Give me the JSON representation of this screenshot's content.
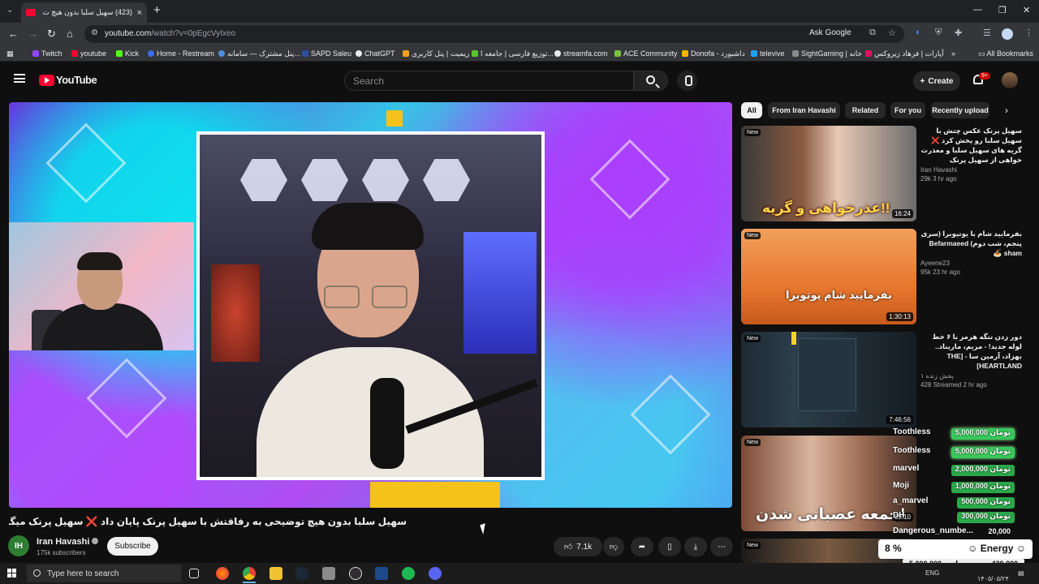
{
  "browser": {
    "tab_title": "(423) سهیل سلبا بدون هیچ ت",
    "url_host": "youtube.com",
    "url_path": "/watch?v=0pEgcVyIxeo",
    "ask_google": "Ask Google"
  },
  "bookmarks": [
    {
      "label": "Twitch",
      "color": "#9146ff"
    },
    {
      "label": "youtube",
      "color": "#ff0033"
    },
    {
      "label": "Kick",
      "color": "#53fc18"
    },
    {
      "label": "Home - Restream",
      "color": "#3d6cf4"
    },
    {
      "label": "پنل مشترک — سامانه...",
      "color": "#4a90e2"
    },
    {
      "label": "SAPD Saleu",
      "color": "#2b4fa3"
    },
    {
      "label": "ChatGPT",
      "color": "#e8eaed"
    },
    {
      "label": "ریمیت | پنل کاربری",
      "color": "#f0a020"
    },
    {
      "label": "توزیع فارسی | جامعه ا...",
      "color": "#5bc236"
    },
    {
      "label": "streamfa.com",
      "color": "#e8eaed"
    },
    {
      "label": "ACE Community",
      "color": "#7cc242"
    },
    {
      "label": "Donofa - داشبورد",
      "color": "#f7b500"
    },
    {
      "label": "televive",
      "color": "#1da1f2"
    },
    {
      "label": "SightGaming | خانه",
      "color": "#8a8a8a"
    },
    {
      "label": "آپارات | فرهاد زیروکس",
      "color": "#e0115f"
    }
  ],
  "all_bookmarks": "All Bookmarks",
  "youtube": {
    "logo": "YouTube",
    "search_placeholder": "Search",
    "create": "Create",
    "notif_count": "9+"
  },
  "video": {
    "title": "سهیل سلبا بدون هیچ توضیحی به رفاقتش با سهیل پرنک پایان داد ❌ سهیل پرنک میگه سلبا ایده منو دزدیده‼️",
    "channel": "Iran Havashi",
    "channel_initials": "IH",
    "subscribers": "175k subscribers",
    "subscribe": "Subscribe",
    "likes": "7.1k"
  },
  "chips": [
    "All",
    "From Iran Havashi",
    "Related",
    "For you",
    "Recently upload"
  ],
  "recommendations": [
    {
      "title": "سهیل پرنک عکس چتش با سهیل سلبا رو پخش کرد ❌ گریه های سهیل سلبا و معذرت خواهی از سهیل پرنک",
      "channel": "Iran Havashi",
      "meta": "29k  3 hr ago",
      "duration": "16:24",
      "new": "New",
      "overlay": "عذرخواهی و گریه!!"
    },
    {
      "title": "بفرمایید شام با یوتیوبرا (سری پنجم، شب دوم) Befarmaeed sham 🍝",
      "channel": "Ayeene23",
      "meta": "95k  23 hr ago",
      "duration": "1:30:13",
      "new": "New",
      "overlay": "بفرمایید شام یوتوبرا"
    },
    {
      "title": "دور زدن تنگه هرمز با ۶ خط لوله جدید! - مریم، ماریناد.. بهزاد، آرمین سا - [THE HEARTLAND]",
      "channel": "پخش زنده ۱",
      "meta": "428  Streamed 2 hr ago",
      "duration": "7:46:56",
      "new": "New",
      "overlay": ""
    },
    {
      "title": "",
      "channel": "",
      "meta": "",
      "duration": "39:10",
      "new": "New",
      "overlay": "جمعه عصبانی شدن!"
    }
  ],
  "donations": [
    {
      "name": "Toothless",
      "amount": "5,000,000 تومان"
    },
    {
      "name": "Toothless",
      "amount": "5,000,000 تومان"
    },
    {
      "name": "marvel",
      "amount": "2,000,000 تومان"
    },
    {
      "name": "Moji",
      "amount": "1,000,000 تومان"
    },
    {
      "name": "a_marvel",
      "amount": "500,000 تومان"
    },
    {
      "name": "DH",
      "amount": "300,000 تومان"
    },
    {
      "name": "Dangerous_numbe...",
      "amount": "20,000"
    }
  ],
  "overlay": {
    "energy_pct": "8 %",
    "energy_label": "Energy",
    "goal_total": "5,000,000",
    "goal_sep": "از",
    "goal_current": "420,000"
  },
  "taskbar": {
    "search_placeholder": "Type here to search",
    "lang": "ENG",
    "date": "۱۴۰۵/۰۵/۲۴"
  }
}
